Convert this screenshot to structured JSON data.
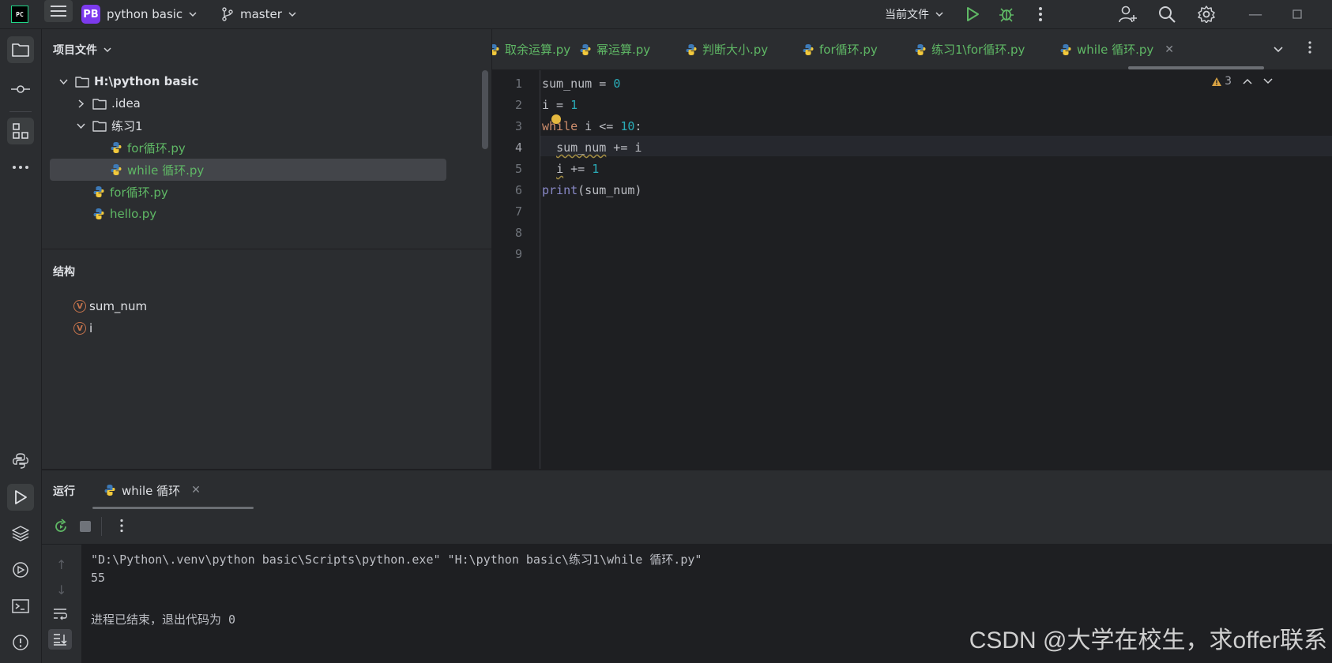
{
  "titlebar": {
    "logo_text": "PC",
    "project_badge": "PB",
    "project_name": "python basic",
    "branch": "master",
    "run_config": "当前文件"
  },
  "project_panel": {
    "title": "项目文件",
    "tree": [
      {
        "label": "H:\\python basic",
        "type": "folder",
        "expanded": true,
        "depth": 0
      },
      {
        "label": ".idea",
        "type": "folder",
        "expanded": false,
        "depth": 1
      },
      {
        "label": "练习1",
        "type": "folder",
        "expanded": true,
        "depth": 1
      },
      {
        "label": "for循环.py",
        "type": "py",
        "depth": 2
      },
      {
        "label": "while 循环.py",
        "type": "py",
        "depth": 2,
        "selected": true
      },
      {
        "label": "for循环.py",
        "type": "py",
        "depth": 1
      },
      {
        "label": "hello.py",
        "type": "py",
        "depth": 1
      }
    ]
  },
  "structure_panel": {
    "title": "结构",
    "items": [
      {
        "badge": "V",
        "label": "sum_num"
      },
      {
        "badge": "V",
        "label": "i"
      }
    ]
  },
  "tabs": [
    {
      "label": "取余运算.py"
    },
    {
      "label": "幂运算.py"
    },
    {
      "label": "判断大小.py"
    },
    {
      "label": "for循环.py"
    },
    {
      "label": "练习1\\for循环.py"
    },
    {
      "label": "while 循环.py",
      "active": true
    }
  ],
  "editor": {
    "line_numbers": [
      "1",
      "2",
      "3",
      "4",
      "5",
      "6",
      "7",
      "8",
      "9"
    ],
    "warning_count": "3",
    "code": {
      "l1_a": "sum_num = ",
      "l1_b": "0",
      "l2_a": "i = ",
      "l2_b": "1",
      "l3_kw": "while",
      "l3_a": " i <= ",
      "l3_b": "10",
      "l3_c": ":",
      "l4_indent": "  ",
      "l4_var": "sum_num",
      "l4_rest": " += i",
      "l5_indent": "  ",
      "l5_var": "i",
      "l5_a": " += ",
      "l5_b": "1",
      "l6_fn": "print",
      "l6_rest": "(sum_num)"
    }
  },
  "run_panel": {
    "title": "运行",
    "tab_label": "while 循环",
    "console": [
      "\"D:\\Python\\.venv\\python basic\\Scripts\\python.exe\" \"H:\\python basic\\练习1\\while 循环.py\"",
      "55",
      "",
      "进程已结束，退出代码为 0"
    ]
  },
  "watermark": "CSDN @大学在校生，求offer联系",
  "colors": {
    "bg": "#1e1f22",
    "panel": "#2b2d30",
    "py_file": "#5fb865",
    "keyword": "#cf8e6d",
    "number": "#2aacb8",
    "run_green": "#5fb865"
  }
}
